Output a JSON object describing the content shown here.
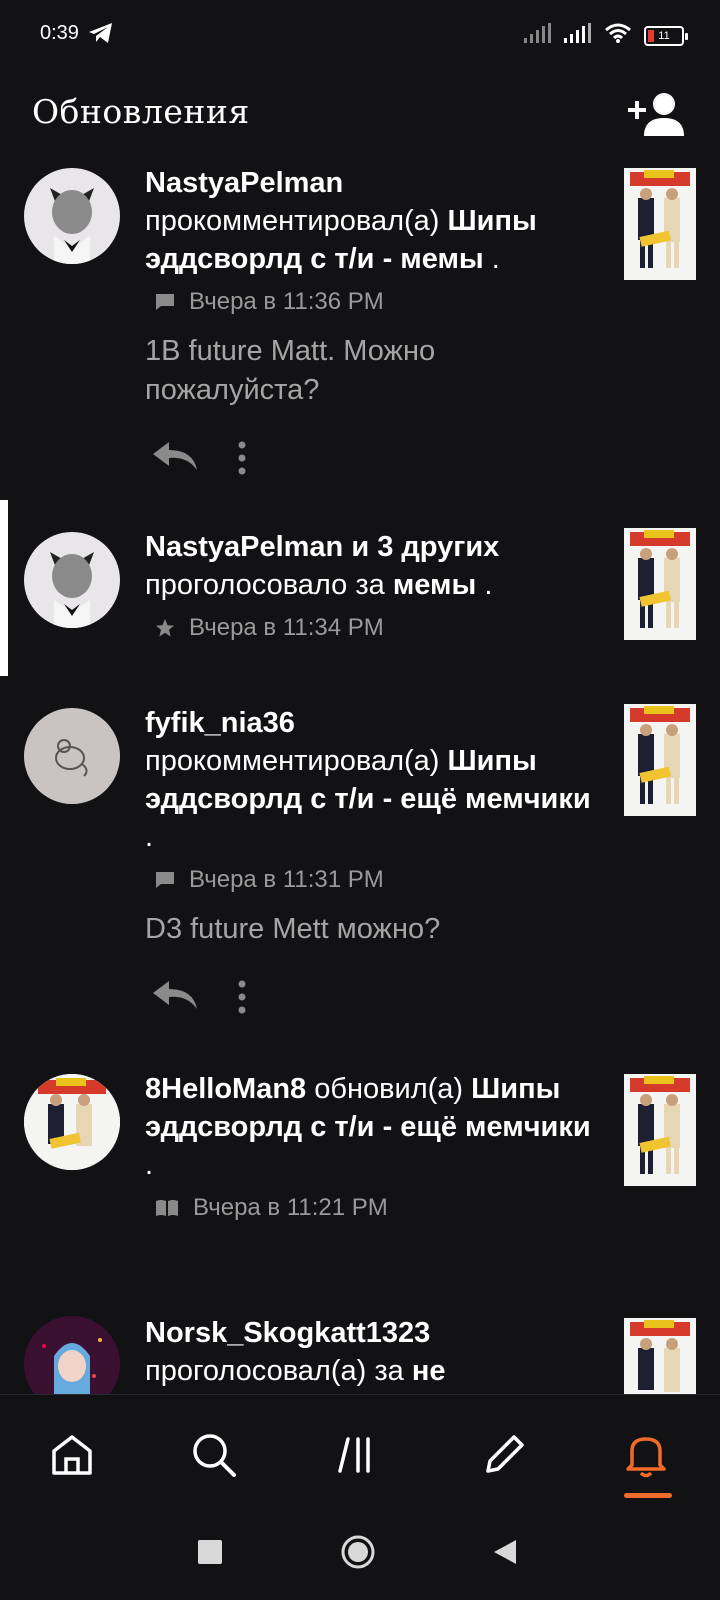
{
  "status_bar": {
    "time": "0:39",
    "battery": "11"
  },
  "header": {
    "title": "Обновления"
  },
  "feed": [
    {
      "user": "NastyaPelman",
      "action": "прокомментировал(а)",
      "target": "Шипы эддсворлд с т/и - мемы",
      "end": ".",
      "timestamp": "Вчера в 11:36 PM",
      "meta_icon": "comment-icon",
      "comment": "1B future Matt. Можно пожалуйста?"
    },
    {
      "user": "NastyaPelman и 3 других",
      "action": "проголосовало за",
      "target": "мемы",
      "end": ".",
      "timestamp": "Вчера в 11:34 PM",
      "meta_icon": "star-icon"
    },
    {
      "user": "fyfik_nia36",
      "action": "прокомментировал(а)",
      "target": "Шипы эддсворлд с т/и - ещё мемчики",
      "end": ".",
      "timestamp": "Вчера в 11:31 PM",
      "meta_icon": "comment-icon",
      "comment": "D3 future Mett можно?"
    },
    {
      "user": "8HelloMan8",
      "action": "обновил(а)",
      "target": "Шипы эддсворлд с т/и - ещё мемчики",
      "end": ".",
      "timestamp": "Вчера в 11:21 PM",
      "meta_icon": "book-icon"
    },
    {
      "user": "Norsk_Skogkatt1323",
      "action": "проголосовал(а) за",
      "target": "не"
    }
  ],
  "bottom_nav": [
    "home-icon",
    "search-icon",
    "library-icon",
    "write-icon",
    "notifications-icon"
  ],
  "colors": {
    "accent": "#f26b2b",
    "background": "#121114",
    "muted": "#9a9a9a"
  }
}
